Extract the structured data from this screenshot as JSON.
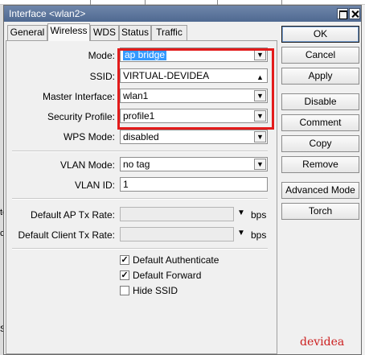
{
  "window": {
    "title": "Interface <wlan2>"
  },
  "tabs": [
    {
      "label": "General",
      "active": false
    },
    {
      "label": "Wireless",
      "active": true
    },
    {
      "label": "WDS",
      "active": false
    },
    {
      "label": "Status",
      "active": false
    },
    {
      "label": "Traffic",
      "active": false
    }
  ],
  "form": {
    "mode": {
      "label": "Mode:",
      "value": "ap bridge"
    },
    "ssid": {
      "label": "SSID:",
      "value": "VIRTUAL-DEVIDEA"
    },
    "master_interface": {
      "label": "Master Interface:",
      "value": "wlan1"
    },
    "security_profile": {
      "label": "Security Profile:",
      "value": "profile1"
    },
    "wps_mode": {
      "label": "WPS Mode:",
      "value": "disabled"
    },
    "vlan_mode": {
      "label": "VLAN Mode:",
      "value": "no tag"
    },
    "vlan_id": {
      "label": "VLAN ID:",
      "value": "1"
    },
    "default_ap_tx_rate": {
      "label": "Default AP Tx Rate:",
      "value": "",
      "unit": "bps"
    },
    "default_client_tx_rate": {
      "label": "Default Client Tx Rate:",
      "value": "",
      "unit": "bps"
    }
  },
  "checkboxes": [
    {
      "label": "Default Authenticate",
      "checked": true
    },
    {
      "label": "Default Forward",
      "checked": true
    },
    {
      "label": "Hide SSID",
      "checked": false
    }
  ],
  "buttons": {
    "ok": "OK",
    "cancel": "Cancel",
    "apply": "Apply",
    "disable": "Disable",
    "comment": "Comment",
    "copy": "Copy",
    "remove": "Remove",
    "advanced_mode": "Advanced Mode",
    "torch": "Torch"
  },
  "watermark": "devidea",
  "background": {
    "left_fragments": [
      "te",
      "cc",
      "S"
    ]
  },
  "colors": {
    "highlight_box": "#e31b1b",
    "selection": "#3399ff",
    "titlebar": "#5b739b",
    "watermark": "#cc1f1f"
  },
  "icons": {
    "dropdown": "triangle-down",
    "collapse": "triangle-up",
    "check": "check-mark"
  }
}
